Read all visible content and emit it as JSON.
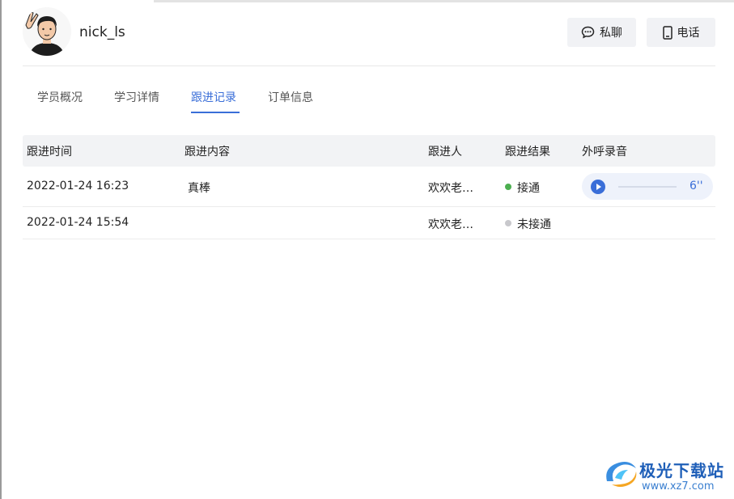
{
  "profile": {
    "name": "nick_ls"
  },
  "header": {
    "chat_label": "私聊",
    "phone_label": "电话"
  },
  "tabs": [
    {
      "label": "学员概况",
      "active": false
    },
    {
      "label": "学习详情",
      "active": false
    },
    {
      "label": "跟进记录",
      "active": true
    },
    {
      "label": "订单信息",
      "active": false
    }
  ],
  "table": {
    "columns": [
      "跟进时间",
      "跟进内容",
      "跟进人",
      "跟进结果",
      "外呼录音"
    ],
    "rows": [
      {
        "time": "2022-01-24 16:23",
        "content": "真棒",
        "person": "欢欢老…",
        "result": "接通",
        "result_color": "#4caf50",
        "recording": "6''"
      },
      {
        "time": "2022-01-24 15:54",
        "content": "",
        "person": "欢欢老…",
        "result": "未接通",
        "result_color": "#c8c8cc",
        "recording": ""
      }
    ]
  },
  "watermark": {
    "title": "极光下载站",
    "url": "www.xz7.com"
  },
  "colors": {
    "accent": "#3a6ed8",
    "connected": "#4caf50",
    "not_connected": "#c8c8cc"
  }
}
